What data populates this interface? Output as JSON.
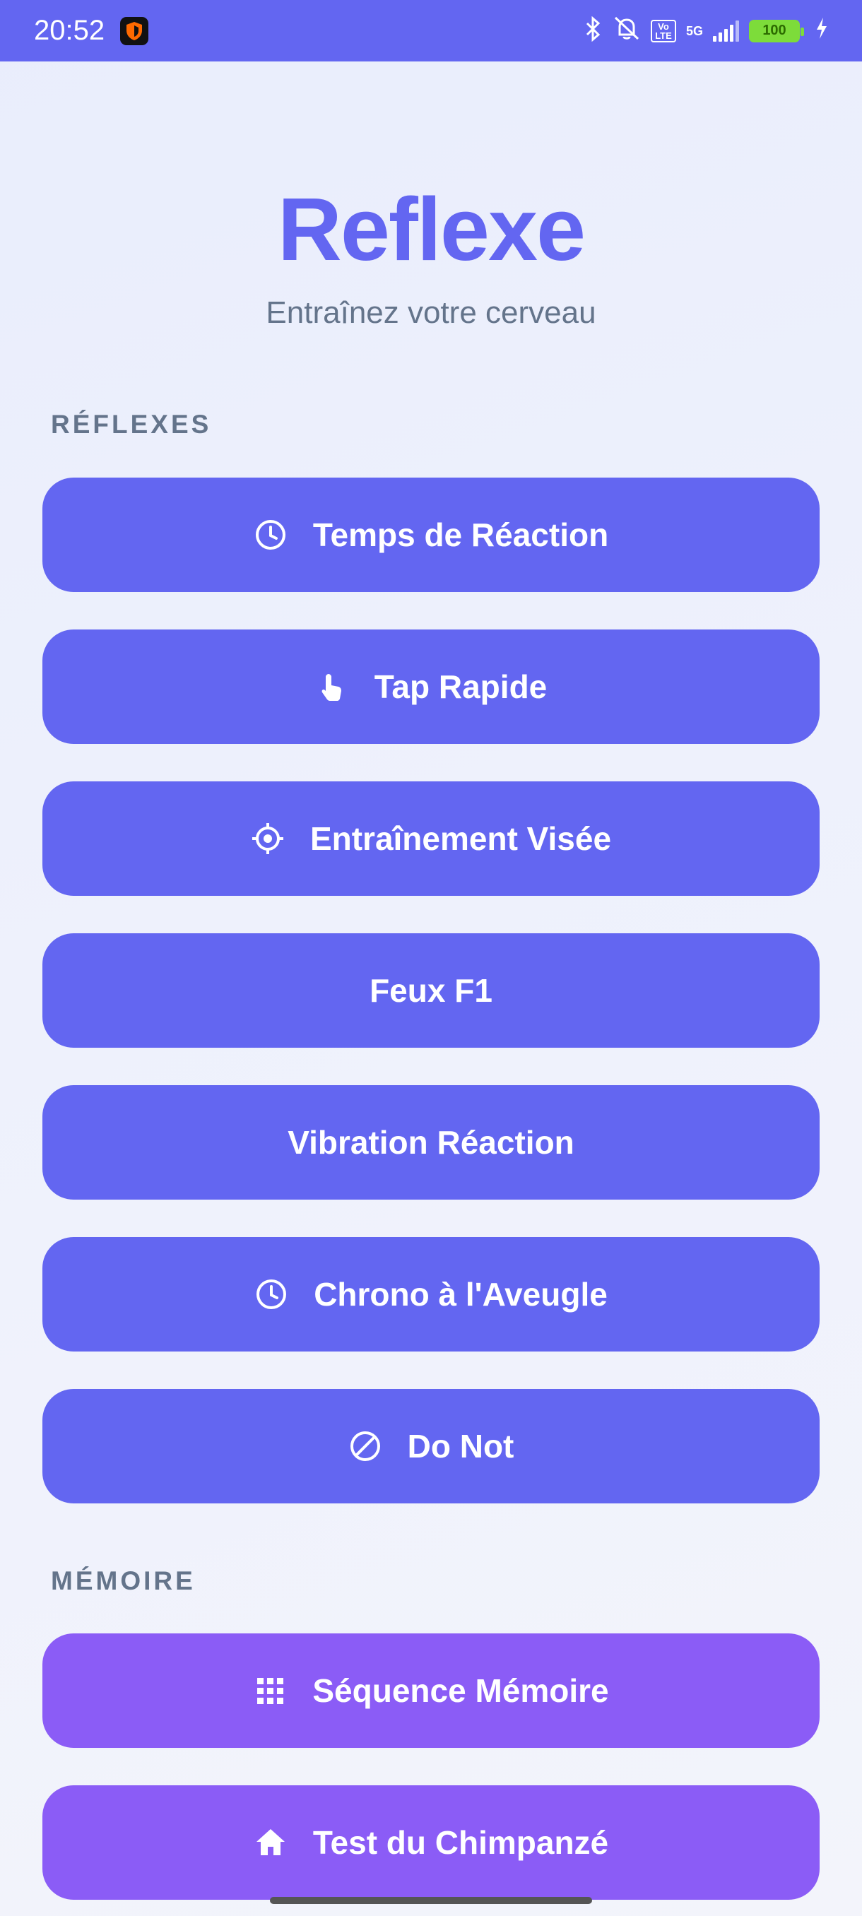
{
  "status_bar": {
    "time": "20:52",
    "volte": "Vo LTE",
    "network": "5G",
    "battery": "100",
    "icons": [
      "app-shield-icon",
      "bluetooth-icon",
      "bell-off-icon",
      "volte-icon",
      "signal-icon",
      "battery-icon",
      "charging-icon"
    ]
  },
  "header": {
    "title": "Reflexe",
    "subtitle": "Entraînez votre cerveau"
  },
  "sections": {
    "reflexes": {
      "label": "RÉFLEXES",
      "buttons": [
        {
          "label": "Temps de Réaction",
          "icon": "clock-icon"
        },
        {
          "label": "Tap Rapide",
          "icon": "tap-hand-icon"
        },
        {
          "label": "Entraînement Visée",
          "icon": "crosshair-icon"
        },
        {
          "label": "Feux F1",
          "icon": ""
        },
        {
          "label": "Vibration Réaction",
          "icon": ""
        },
        {
          "label": "Chrono à l'Aveugle",
          "icon": "clock-icon"
        },
        {
          "label": "Do Not",
          "icon": "prohibited-icon"
        }
      ]
    },
    "memoire": {
      "label": "MÉMOIRE",
      "buttons": [
        {
          "label": "Séquence Mémoire",
          "icon": "grid-icon"
        },
        {
          "label": "Test du Chimpanzé",
          "icon": "home-icon"
        }
      ]
    }
  },
  "colors": {
    "primary": "#6366f1",
    "secondary": "#8b5cf6",
    "muted_text": "#64748b",
    "background": "#eef1fc"
  }
}
